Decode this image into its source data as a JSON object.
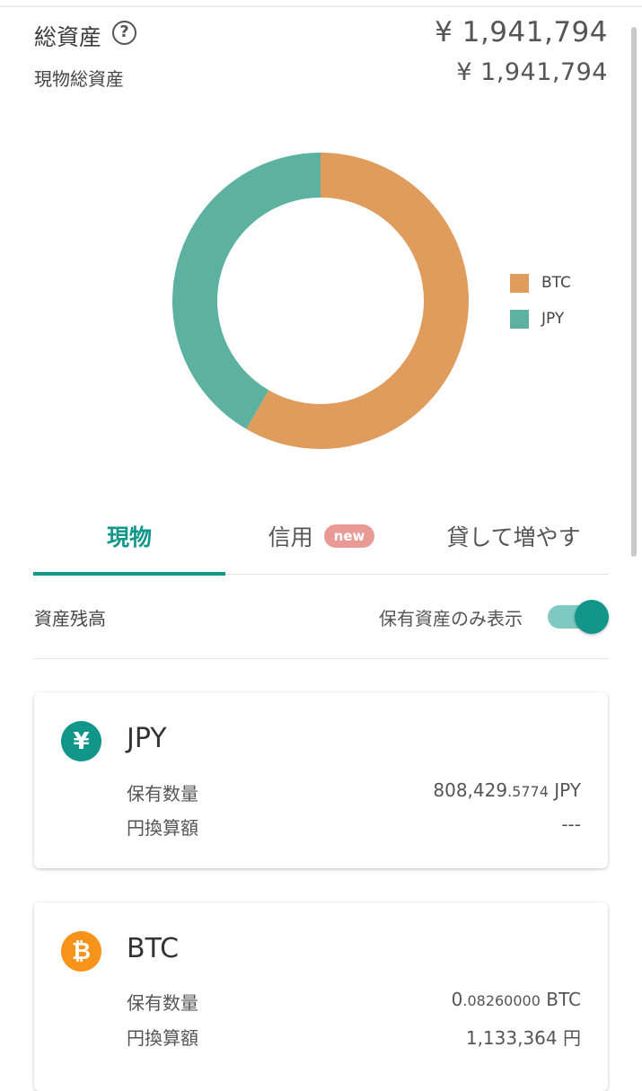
{
  "summary": {
    "total_label": "総資産",
    "total_value": "¥ 1,941,794",
    "spot_label": "現物総資産",
    "spot_value": "¥ 1,941,794"
  },
  "chart_data": {
    "type": "pie",
    "style": "donut",
    "categories": [
      "BTC",
      "JPY"
    ],
    "values": [
      1133364,
      808430
    ],
    "colors": [
      "#df9c5d",
      "#5cb1a0"
    ],
    "legend_position": "right"
  },
  "tabs": [
    {
      "label": "現物",
      "active": true
    },
    {
      "label": "信用",
      "badge": "new"
    },
    {
      "label": "貸して増やす"
    }
  ],
  "balance": {
    "title": "資産残高",
    "toggle_label": "保有資産のみ表示",
    "toggle_on": true
  },
  "assets": [
    {
      "name": "JPY",
      "icon": "yen-icon",
      "icon_color": "#12968a",
      "holding_label": "保有数量",
      "holding_main": "808,429",
      "holding_small": ".5774",
      "holding_unit": " JPY",
      "jpy_label": "円換算額",
      "jpy_value": "---"
    },
    {
      "name": "BTC",
      "icon": "bitcoin-icon",
      "icon_color": "#f7931a",
      "holding_label": "保有数量",
      "holding_main": "0",
      "holding_small": ".08260000",
      "holding_unit": " BTC",
      "jpy_label": "円換算額",
      "jpy_value": "1,133,364 円"
    }
  ]
}
